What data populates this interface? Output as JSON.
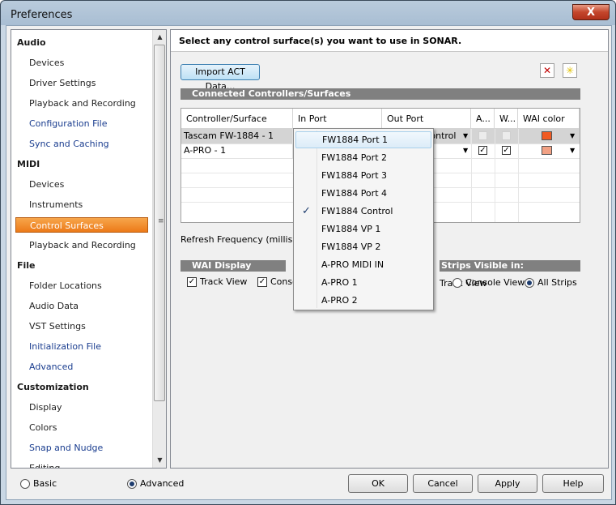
{
  "window": {
    "title": "Preferences",
    "close_glyph": "X"
  },
  "tree": {
    "items": [
      {
        "kind": "cat",
        "label": "Audio"
      },
      {
        "kind": "sub",
        "label": "Devices"
      },
      {
        "kind": "sub",
        "label": "Driver Settings"
      },
      {
        "kind": "sub",
        "label": "Playback and Recording"
      },
      {
        "kind": "sub",
        "label": "Configuration File",
        "blue": true
      },
      {
        "kind": "sub",
        "label": "Sync and Caching",
        "blue": true
      },
      {
        "kind": "cat",
        "label": "MIDI"
      },
      {
        "kind": "sub",
        "label": "Devices"
      },
      {
        "kind": "sub",
        "label": "Instruments"
      },
      {
        "kind": "sel",
        "label": "Control Surfaces"
      },
      {
        "kind": "sub",
        "label": "Playback and Recording"
      },
      {
        "kind": "cat",
        "label": "File"
      },
      {
        "kind": "sub",
        "label": "Folder Locations"
      },
      {
        "kind": "sub",
        "label": "Audio Data"
      },
      {
        "kind": "sub",
        "label": "VST Settings"
      },
      {
        "kind": "sub",
        "label": "Initialization File",
        "blue": true
      },
      {
        "kind": "sub",
        "label": "Advanced",
        "blue": true
      },
      {
        "kind": "cat",
        "label": "Customization"
      },
      {
        "kind": "sub",
        "label": "Display"
      },
      {
        "kind": "sub",
        "label": "Colors"
      },
      {
        "kind": "sub",
        "label": "Snap and Nudge",
        "blue": true
      },
      {
        "kind": "sub",
        "label": "Editing"
      }
    ]
  },
  "pane": {
    "header": "Select any control surface(s) you want to use in SONAR.",
    "import_button": "Import ACT Data...",
    "connected_section": "Connected Controllers/Surfaces",
    "columns": [
      "Controller/Surface",
      "In Port",
      "Out Port",
      "A...",
      "W...",
      "WAI color"
    ],
    "rows": [
      {
        "controller": "Tascam FW-1884 - 1",
        "out_port": "FW1884 Control",
        "wai_color": "#f05a22"
      },
      {
        "controller": "A-PRO - 1",
        "out_port": "",
        "wai_color": "#f2a184"
      }
    ],
    "refresh_label": "Refresh Frequency (milliseconds):",
    "wai_section": "WAI Display",
    "track_view_label": "Track View",
    "console_view_label": "Console View",
    "strips_section": "Strips Visible in:",
    "strips_track_label": "Track View",
    "strips_console_label": "Console View",
    "strips_all_label": "All Strips"
  },
  "dropdown": {
    "items": [
      {
        "label": "FW1884 Port 1",
        "highlighted": true,
        "checked": false
      },
      {
        "label": "FW1884 Port 2",
        "highlighted": false,
        "checked": false
      },
      {
        "label": "FW1884 Port 3",
        "highlighted": false,
        "checked": false
      },
      {
        "label": "FW1884 Port 4",
        "highlighted": false,
        "checked": false
      },
      {
        "label": "FW1884 Control",
        "highlighted": false,
        "checked": true
      },
      {
        "label": "FW1884 VP 1",
        "highlighted": false,
        "checked": false
      },
      {
        "label": "FW1884 VP 2",
        "highlighted": false,
        "checked": false
      },
      {
        "label": "A-PRO MIDI IN",
        "highlighted": false,
        "checked": false
      },
      {
        "label": "A-PRO 1",
        "highlighted": false,
        "checked": false
      },
      {
        "label": "A-PRO 2",
        "highlighted": false,
        "checked": false
      }
    ]
  },
  "footer": {
    "basic_label": "Basic",
    "advanced_label": "Advanced",
    "mode_selected": "Advanced",
    "ok": "OK",
    "cancel": "Cancel",
    "apply": "Apply",
    "help": "Help"
  },
  "colors": {
    "selection": "#ec7a18",
    "section_bar": "#808080",
    "delete_icon": "#c00000"
  }
}
